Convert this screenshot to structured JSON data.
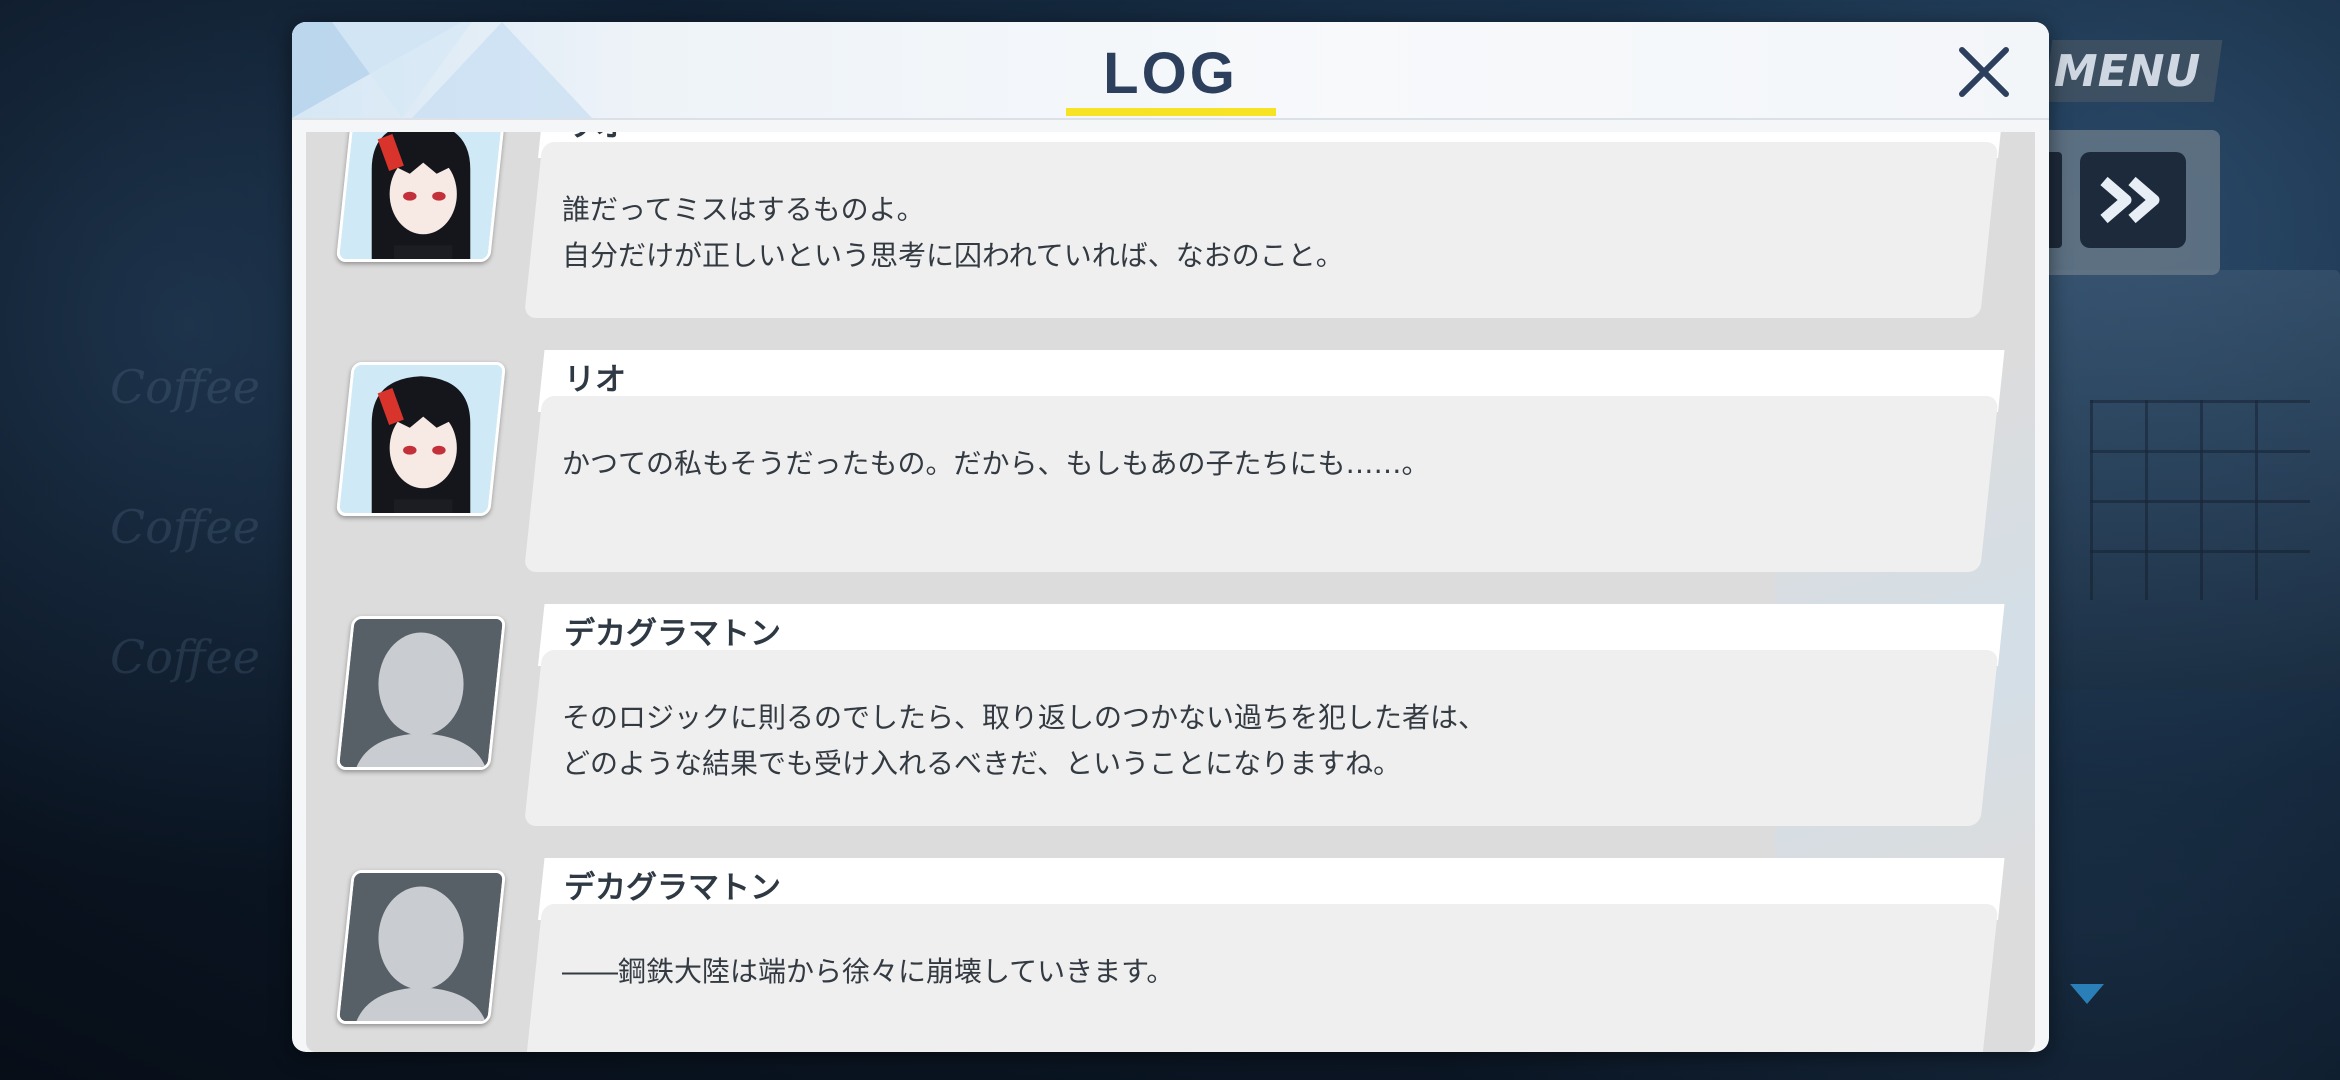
{
  "window": {
    "title": "LOG"
  },
  "hud": {
    "menu_label": "MENU"
  },
  "background_text": [
    "Coffee",
    "Coffee",
    "Coffee"
  ],
  "entries": [
    {
      "speaker": "リオ",
      "avatar": "rio",
      "lines": [
        "誰だってミスはするものよ。",
        "自分だけが正しいという思考に囚われていれば、なおのこと。"
      ]
    },
    {
      "speaker": "リオ",
      "avatar": "rio",
      "lines": [
        "かつての私もそうだったもの。だから、もしもあの子たちにも……。"
      ]
    },
    {
      "speaker": "デカグラマトン",
      "avatar": "unknown",
      "lines": [
        "そのロジックに則るのでしたら、取り返しのつかない過ちを犯した者は、",
        "どのような結果でも受け入れるべきだ、ということになりますね。"
      ]
    },
    {
      "speaker": "デカグラマトン",
      "avatar": "unknown",
      "lines": [
        "――鋼鉄大陸は端から徐々に崩壊していきます。"
      ]
    }
  ],
  "colors": {
    "title": "#2c3f5c",
    "underline": "#f7e224",
    "scroll_arrow": "#2b7fb8"
  }
}
